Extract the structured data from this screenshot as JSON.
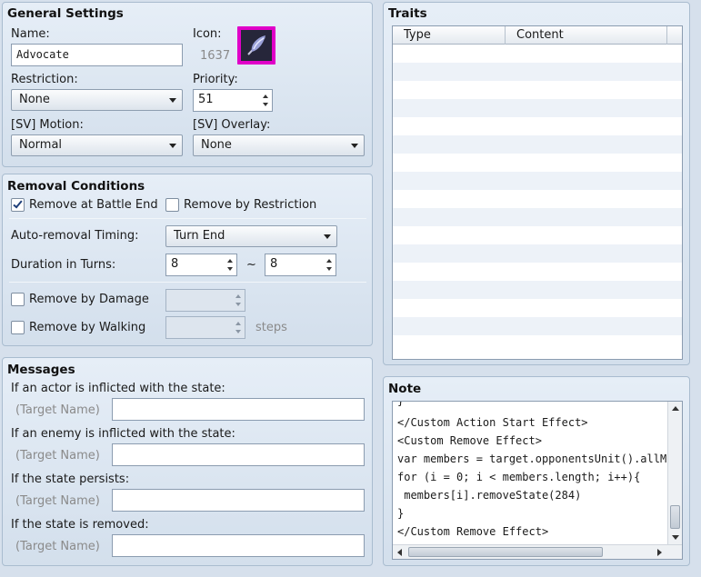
{
  "general": {
    "title": "General Settings",
    "name_label": "Name:",
    "name_value": "Advocate",
    "icon_label": "Icon:",
    "icon_index": "1637",
    "restriction_label": "Restriction:",
    "restriction_value": "None",
    "priority_label": "Priority:",
    "priority_value": "51",
    "sv_motion_label": "[SV] Motion:",
    "sv_motion_value": "Normal",
    "sv_overlay_label": "[SV] Overlay:",
    "sv_overlay_value": "None",
    "icon_glyph": "feather-icon"
  },
  "removal": {
    "title": "Removal Conditions",
    "remove_battle_end": "Remove at Battle End",
    "remove_battle_end_checked": true,
    "remove_restriction": "Remove by Restriction",
    "remove_restriction_checked": false,
    "auto_timing_label": "Auto-removal Timing:",
    "auto_timing_value": "Turn End",
    "duration_label": "Duration in Turns:",
    "duration_min": "8",
    "duration_tilde": "~",
    "duration_max": "8",
    "remove_damage": "Remove by Damage",
    "remove_walking": "Remove by Walking",
    "steps_label": "steps"
  },
  "messages": {
    "title": "Messages",
    "actor_label": "If an actor is inflicted with the state:",
    "enemy_label": "If an enemy is inflicted with the state:",
    "persists_label": "If the state persists:",
    "removed_label": "If the state is removed:",
    "target_name": "(Target Name)"
  },
  "traits": {
    "title": "Traits",
    "col_type": "Type",
    "col_content": "Content"
  },
  "note": {
    "title": "Note",
    "lines": [
      "}",
      "</Custom Action Start Effect>",
      "<Custom Remove Effect>",
      "var members = target.opponentsUnit().allMem",
      "for (i = 0; i < members.length; i++){",
      " members[i].removeState(284)",
      "}",
      "</Custom Remove Effect>"
    ]
  },
  "colors": {
    "icon_frame": "#e000c8",
    "panel_bg": "#d6e0ec"
  }
}
